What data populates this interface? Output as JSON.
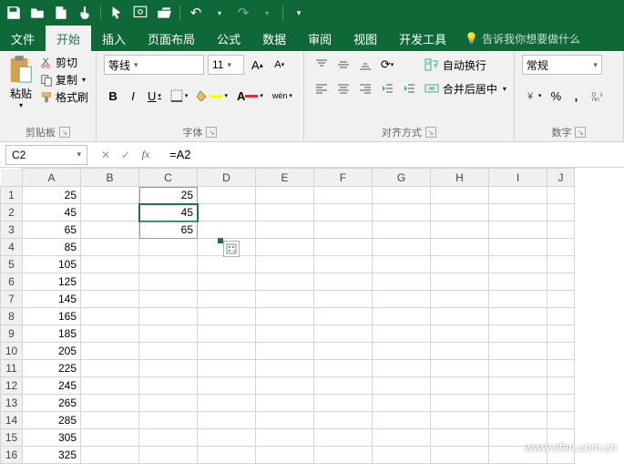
{
  "quickaccess": {
    "icons": [
      "save-icon",
      "undo-quick-icon",
      "new-icon",
      "touch-icon",
      "pointer-icon",
      "preview-icon",
      "open-icon"
    ],
    "undo_label": "↶",
    "redo_label": "↷"
  },
  "tabs": {
    "items": [
      {
        "label": "文件"
      },
      {
        "label": "开始"
      },
      {
        "label": "插入"
      },
      {
        "label": "页面布局"
      },
      {
        "label": "公式"
      },
      {
        "label": "数据"
      },
      {
        "label": "审阅"
      },
      {
        "label": "视图"
      },
      {
        "label": "开发工具"
      }
    ],
    "active_index": 1,
    "tell_me": "告诉我你想要做什么"
  },
  "ribbon": {
    "clipboard": {
      "paste": "粘贴",
      "cut": "剪切",
      "copy": "复制",
      "format_painter": "格式刷",
      "group_label": "剪贴板"
    },
    "font": {
      "font_name": "等线",
      "font_size": "11",
      "bold": "B",
      "italic": "I",
      "underline": "U",
      "wen": "wén",
      "group_label": "字体"
    },
    "alignment": {
      "wrap_text": "自动换行",
      "merge_center": "合并后居中",
      "group_label": "对齐方式"
    },
    "number": {
      "format": "常规",
      "percent": "%",
      "comma": ",",
      "group_label": "数字"
    }
  },
  "formulabar": {
    "cell_ref": "C2",
    "formula": "=A2"
  },
  "grid": {
    "cols": [
      "A",
      "B",
      "C",
      "D",
      "E",
      "F",
      "G",
      "H",
      "I",
      "J"
    ],
    "rows": 16,
    "colA": [
      "25",
      "45",
      "65",
      "85",
      "105",
      "125",
      "145",
      "165",
      "185",
      "205",
      "225",
      "245",
      "265",
      "285",
      "305",
      "325"
    ],
    "colC": [
      "25",
      "45",
      "65",
      "",
      "",
      "",
      "",
      "",
      "",
      "",
      "",
      "",
      "",
      "",
      "",
      ""
    ],
    "selected": "C2"
  },
  "watermark": "www.cfan.com.cn"
}
